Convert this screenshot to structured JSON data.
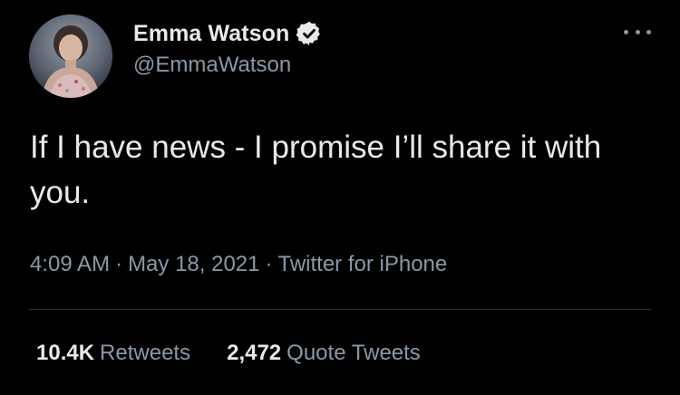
{
  "author": {
    "display_name": "Emma Watson",
    "handle": "@EmmaWatson",
    "verified": true
  },
  "tweet": {
    "text": "If I have news - I promise I’ll share it with you.",
    "time": "4:09 AM",
    "date": "May 18, 2021",
    "source": "Twitter for iPhone",
    "separator": "·"
  },
  "stats": {
    "retweets_count": "10.4K",
    "retweets_label": "Retweets",
    "quote_tweets_count": "2,472",
    "quote_tweets_label": "Quote Tweets"
  },
  "icons": {
    "verified": "verified-badge-icon",
    "more": "more-options-icon"
  },
  "colors": {
    "background": "#000000",
    "primary_text": "#e7e9ea",
    "secondary_text": "#8b98a5",
    "divider": "#2f3336"
  }
}
